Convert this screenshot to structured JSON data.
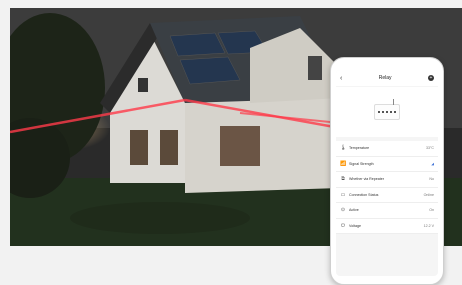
{
  "app": {
    "title": "Relay",
    "back_icon": "back-arrow-icon",
    "add_icon": "plus-icon"
  },
  "status_rows": [
    {
      "icon": "thermometer-icon",
      "label": "Temperature",
      "value": "33°C"
    },
    {
      "icon": "signal-icon",
      "label": "Signal Strength",
      "value": ""
    },
    {
      "icon": "repeater-icon",
      "label": "Whether via Repeater",
      "value": "No"
    },
    {
      "icon": "monitor-icon",
      "label": "Connection Status",
      "value": "Online"
    },
    {
      "icon": "toggle-icon",
      "label": "Active",
      "value": "On"
    },
    {
      "icon": "plug-icon",
      "label": "Voltage",
      "value": "12.2 V"
    }
  ],
  "colors": {
    "accent": "#3b6fd6",
    "laser": "#ff3b4a"
  }
}
